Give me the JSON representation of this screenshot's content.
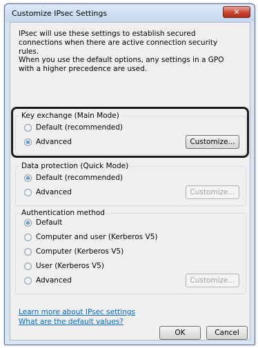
{
  "window": {
    "title": "Customize IPsec Settings",
    "close_glyph": "✕"
  },
  "intro": {
    "line1": "IPsec will use these settings to establish secured connections when there are active connection security rules.",
    "line2": "When you use the default options, any settings in a GPO with a higher precedence are used."
  },
  "key_exchange": {
    "label": "Key exchange (Main Mode)",
    "options": [
      "Default (recommended)",
      "Advanced"
    ],
    "selected": "Advanced",
    "customize": "Customize..."
  },
  "data_protection": {
    "label": "Data protection (Quick Mode)",
    "options": [
      "Default (recommended)",
      "Advanced"
    ],
    "selected": "Default (recommended)",
    "customize": "Customize..."
  },
  "authentication": {
    "label": "Authentication method",
    "options": [
      "Default",
      "Computer and user (Kerberos V5)",
      "Computer (Kerberos V5)",
      "User (Kerberos V5)",
      "Advanced"
    ],
    "selected": "Default",
    "customize": "Customize..."
  },
  "links": {
    "learn_more": "Learn more about IPsec settings",
    "defaults": "What are the default values?"
  },
  "buttons": {
    "ok": "OK",
    "cancel": "Cancel"
  }
}
